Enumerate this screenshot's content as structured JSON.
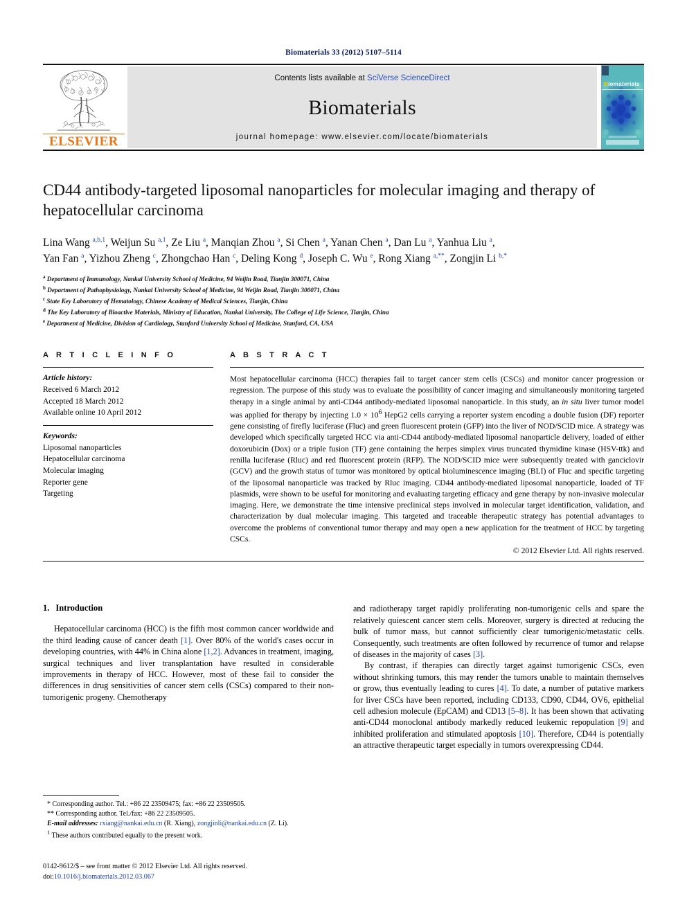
{
  "running_head": "Biomaterials 33 (2012) 5107–5114",
  "masthead": {
    "publisher_name": "ELSEVIER",
    "contents_prefix": "Contents lists available at ",
    "contents_link": "SciVerse ScienceDirect",
    "journal_title": "Biomaterials",
    "homepage": "journal homepage: www.elsevier.com/locate/biomaterials",
    "cover_label_first": "B",
    "cover_label_rest": "iomaterials",
    "cover_color": "#3aa8b5",
    "link_color": "#2a4fbb"
  },
  "article": {
    "title": "CD44 antibody-targeted liposomal nanoparticles for molecular imaging and therapy of hepatocellular carcinoma",
    "authors_line1": "Lina Wang a,b,1, Weijun Su a,1, Ze Liu a, Manqian Zhou a, Si Chen a, Yanan Chen a, Dan Lu a, Yanhua Liu a,",
    "authors_line2": "Yan Fan a, Yizhou Zheng c, Zhongchao Han c, Deling Kong d, Joseph C. Wu e, Rong Xiang a,**, Zongjin Li b,*",
    "affiliations": [
      {
        "mark": "a",
        "text": "Department of Immunology, Nankai University School of Medicine, 94 Weijin Road, Tianjin 300071, China"
      },
      {
        "mark": "b",
        "text": "Department of Pathophysiology, Nankai University School of Medicine, 94 Weijin Road, Tianjin 300071, China"
      },
      {
        "mark": "c",
        "text": "State Key Laboratory of Hematology, Chinese Academy of Medical Sciences, Tianjin, China"
      },
      {
        "mark": "d",
        "text": "The Key Laboratory of Bioactive Materials, Ministry of Education, Nankai University, The College of Life Science, Tianjin, China"
      },
      {
        "mark": "e",
        "text": "Department of Medicine, Division of Cardiology, Stanford University School of Medicine, Stanford, CA, USA"
      }
    ]
  },
  "article_info": {
    "heading": "A R T I C L E  I N F O",
    "history_label": "Article history:",
    "history": [
      "Received 6 March 2012",
      "Accepted 18 March 2012",
      "Available online 10 April 2012"
    ],
    "keywords_label": "Keywords:",
    "keywords": [
      "Liposomal nanoparticles",
      "Hepatocellular carcinoma",
      "Molecular imaging",
      "Reporter gene",
      "Targeting"
    ]
  },
  "abstract": {
    "heading": "A B S T R A C T",
    "text_part1": "Most hepatocellular carcinoma (HCC) therapies fail to target cancer stem cells (CSCs) and monitor cancer progression or regression. The purpose of this study was to evaluate the possibility of cancer imaging and simultaneously monitoring targeted therapy in a single animal by anti-CD44 antibody-mediated liposomal nanoparticle. In this study, an ",
    "italic1": "in situ",
    "text_part2": " liver tumor model was applied for therapy by injecting 1.0 × 10",
    "sup1": "6",
    "text_part3": " HepG2 cells carrying a reporter system encoding a double fusion (DF) reporter gene consisting of firefly luciferase (Fluc) and green fluorescent protein (GFP) into the liver of NOD/SCID mice. A strategy was developed which specifically targeted HCC via anti-CD44 antibody-mediated liposomal nanoparticle delivery, loaded of either doxorubicin (Dox) or a triple fusion (TF) gene containing the herpes simplex virus truncated thymidine kinase (HSV-ttk) and renilla luciferase (Rluc) and red fluorescent protein (RFP). The NOD/SCID mice were subsequently treated with ganciclovir (GCV) and the growth status of tumor was monitored by optical bioluminescence imaging (BLI) of Fluc and specific targeting of the liposomal nanoparticle was tracked by Rluc imaging. CD44 antibody-mediated liposomal nanoparticle, loaded of TF plasmids, were shown to be useful for monitoring and evaluating targeting efficacy and gene therapy by non-invasive molecular imaging. Here, we demonstrate the time intensive preclinical steps involved in molecular target identification, validation, and characterization by dual molecular imaging. This targeted and traceable therapeutic strategy has potential advantages to overcome the problems of conventional tumor therapy and may open a new application for the treatment of HCC by targeting CSCs.",
    "copyright": "© 2012 Elsevier Ltd. All rights reserved."
  },
  "introduction": {
    "number": "1.",
    "heading": "Introduction",
    "left_paragraph": "Hepatocellular carcinoma (HCC) is the fifth most common cancer worldwide and the third leading cause of cancer death [1]. Over 80% of the world's cases occur in developing countries, with 44% in China alone [1,2]. Advances in treatment, imaging, surgical techniques and liver transplantation have resulted in considerable improvements in therapy of HCC. However, most of these fail to consider the differences in drug sensitivities of cancer stem cells (CSCs) compared to their non-tumorigenic progeny. Chemotherapy",
    "right_paragraph_1": "and radiotherapy target rapidly proliferating non-tumorigenic cells and spare the relatively quiescent cancer stem cells. Moreover, surgery is directed at reducing the bulk of tumor mass, but cannot sufficiently clear tumorigenic/metastatic cells. Consequently, such treatments are often followed by recurrence of tumor and relapse of diseases in the majority of cases [3].",
    "right_paragraph_2": "By contrast, if therapies can directly target against tumorigenic CSCs, even without shrinking tumors, this may render the tumors unable to maintain themselves or grow, thus eventually leading to cures [4]. To date, a number of putative markers for liver CSCs have been reported, including CD133, CD90, CD44, OV6, epithelial cell adhesion molecule (EpCAM) and CD13 [5–8]. It has been shown that activating anti-CD44 monoclonal antibody markedly reduced leukemic repopulation [9] and inhibited proliferation and stimulated apoptosis [10]. Therefore, CD44 is potentially an attractive therapeutic target especially in tumors overexpressing CD44."
  },
  "footnotes": {
    "corresponding1": "* Corresponding author. Tel.: +86 22 23509475; fax: +86 22 23509505.",
    "corresponding2": "** Corresponding author. Tel./fax: +86 22 23509505.",
    "email_label": "E-mail addresses:",
    "email1": "rxiang@nankai.edu.cn",
    "email1_attr": "(R. Xiang),",
    "email2": "zongjinli@nankai.edu.cn",
    "email2_attr": "(Z. Li).",
    "equal_contrib_mark": "1",
    "equal_contrib": "These authors contributed equally to the present work."
  },
  "footer": {
    "issn_line": "0142-9612/$ – see front matter © 2012 Elsevier Ltd. All rights reserved.",
    "doi_prefix": "doi:",
    "doi": "10.1016/j.biomaterials.2012.03.067"
  }
}
